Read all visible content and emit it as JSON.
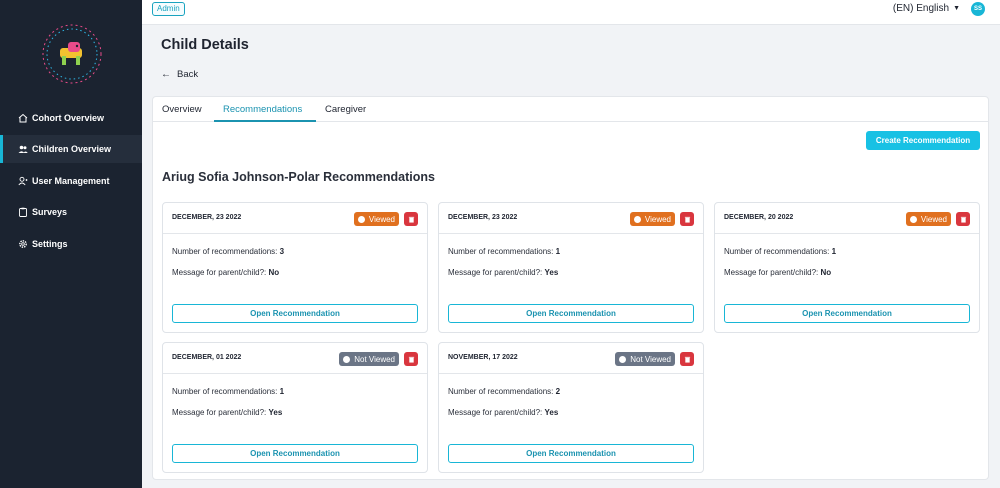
{
  "topbar": {
    "admin_label": "Admin",
    "language": "(EN) English",
    "avatar_initials": "SS"
  },
  "sidebar": {
    "items": [
      {
        "label": "Cohort Overview",
        "icon": "home-icon"
      },
      {
        "label": "Children Overview",
        "icon": "users-icon"
      },
      {
        "label": "User Management",
        "icon": "user-icon"
      },
      {
        "label": "Surveys",
        "icon": "clipboard-icon"
      },
      {
        "label": "Settings",
        "icon": "gear-icon"
      }
    ],
    "active_index": 1
  },
  "page": {
    "title": "Child Details",
    "back_label": "Back"
  },
  "tabs": [
    {
      "label": "Overview"
    },
    {
      "label": "Recommendations"
    },
    {
      "label": "Caregiver"
    }
  ],
  "active_tab": 1,
  "create_button": "Create Recommendation",
  "section_title": "Ariug Sofia Johnson-Polar Recommendations",
  "labels": {
    "num_recs": "Number of recommendations:",
    "message": "Message for parent/child?:",
    "open": "Open Recommendation"
  },
  "cards": [
    {
      "date": "DECEMBER, 23 2022",
      "status": "Viewed",
      "count": "3",
      "message": "No"
    },
    {
      "date": "DECEMBER, 23 2022",
      "status": "Viewed",
      "count": "1",
      "message": "Yes"
    },
    {
      "date": "DECEMBER, 20 2022",
      "status": "Viewed",
      "count": "1",
      "message": "No"
    },
    {
      "date": "DECEMBER, 01 2022",
      "status": "Not Viewed",
      "count": "1",
      "message": "Yes"
    },
    {
      "date": "NOVEMBER, 17 2022",
      "status": "Not Viewed",
      "count": "2",
      "message": "Yes"
    }
  ],
  "colors": {
    "sidebar_bg": "#1b2330",
    "accent": "#18b6d6",
    "viewed": "#e0701f",
    "not_viewed": "#6b7586",
    "delete": "#d9363e"
  }
}
